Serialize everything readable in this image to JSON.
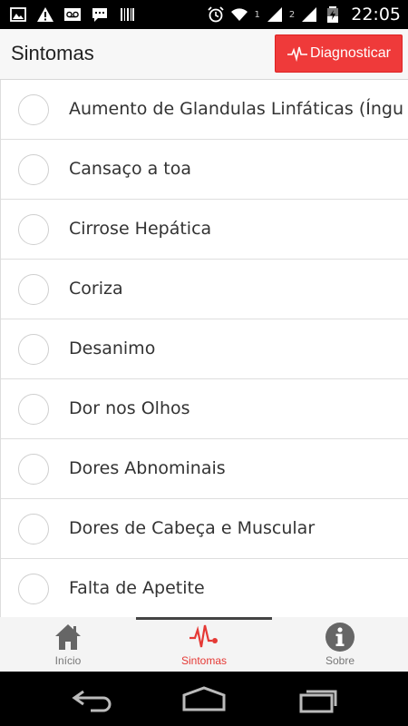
{
  "status_bar": {
    "time": "22:05",
    "sim1": "1",
    "sim2": "2",
    "icons": [
      "image-icon",
      "warning-icon",
      "voicemail-icon",
      "chat-icon",
      "barcode-icon",
      "alarm-icon",
      "wifi-icon",
      "signal-icon",
      "battery-icon"
    ]
  },
  "header": {
    "title": "Sintomas",
    "diagnose_label": "Diagnosticar",
    "accent_color": "#ef3a3a"
  },
  "symptoms": [
    "Aumento de Glandulas Linfáticas (Íngu",
    "Cansaço a toa",
    "Cirrose Hepática",
    "Coriza",
    "Desanimo",
    "Dor nos Olhos",
    "Dores Abnominais",
    "Dores de Cabeça e Muscular",
    "Falta de Apetite"
  ],
  "bottom_nav": {
    "items": [
      {
        "label": "Início",
        "icon": "home-icon"
      },
      {
        "label": "Sintomas",
        "icon": "heartbeat-icon"
      },
      {
        "label": "Sobre",
        "icon": "info-icon"
      }
    ],
    "active": "Sintomas",
    "active_color": "#e53935"
  },
  "system_nav": {
    "buttons": [
      "back-icon",
      "home-button-icon",
      "recent-apps-icon"
    ]
  }
}
